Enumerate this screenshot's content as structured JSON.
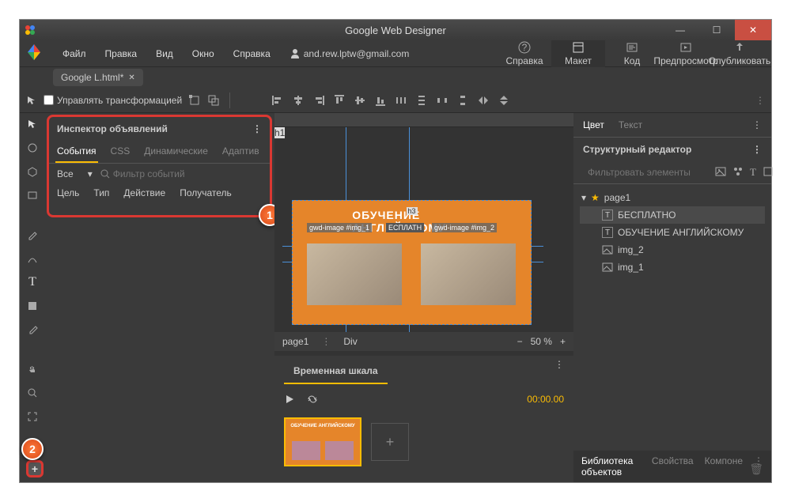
{
  "titlebar": {
    "title": "Google Web Designer"
  },
  "menu": {
    "items": [
      "Файл",
      "Правка",
      "Вид",
      "Окно",
      "Справка"
    ],
    "user": "and.rew.lptw@gmail.com"
  },
  "topbuttons": {
    "help": "Справка",
    "layout": "Макет",
    "code": "Код",
    "preview": "Предпросмотр",
    "publish": "Опубликовать"
  },
  "tab": {
    "name": "Google L.html*"
  },
  "toolbar": {
    "transform": "Управлять трансформацией"
  },
  "inspector": {
    "title": "Инспектор объявлений",
    "tabs": [
      "События",
      "CSS",
      "Динамические",
      "Адаптив"
    ],
    "filter_all": "Все",
    "filter_placeholder": "Фильтр событий",
    "headers": [
      "Цель",
      "Тип",
      "Действие",
      "Получатель"
    ]
  },
  "canvas": {
    "h1_tag": "h1",
    "h3_tag": "h3",
    "headline": "ОБУЧЕНИЕ АНГЛИЙСКОМУ",
    "label1": "gwd-image #img_1",
    "label2": "gwd-image #img_2",
    "sublabel": "ЕСПЛАТН",
    "page": "page1",
    "mode": "Div",
    "zoom": "50 %"
  },
  "timeline": {
    "title": "Временная шкала",
    "time": "00:00.00"
  },
  "rightpanel": {
    "tabs": [
      "Цвет",
      "Текст"
    ],
    "struct_title": "Структурный редактор",
    "filter_placeholder": "Фильтровать элементы",
    "tree": {
      "root": "page1",
      "items": [
        "БЕСПЛАТНО",
        "ОБУЧЕНИЕ АНГЛИЙСКОМУ",
        "img_2",
        "img_1"
      ]
    },
    "bottom_tabs": [
      "Библиотека объектов",
      "Свойства",
      "Компоне"
    ]
  },
  "badges": {
    "one": "1",
    "two": "2"
  }
}
